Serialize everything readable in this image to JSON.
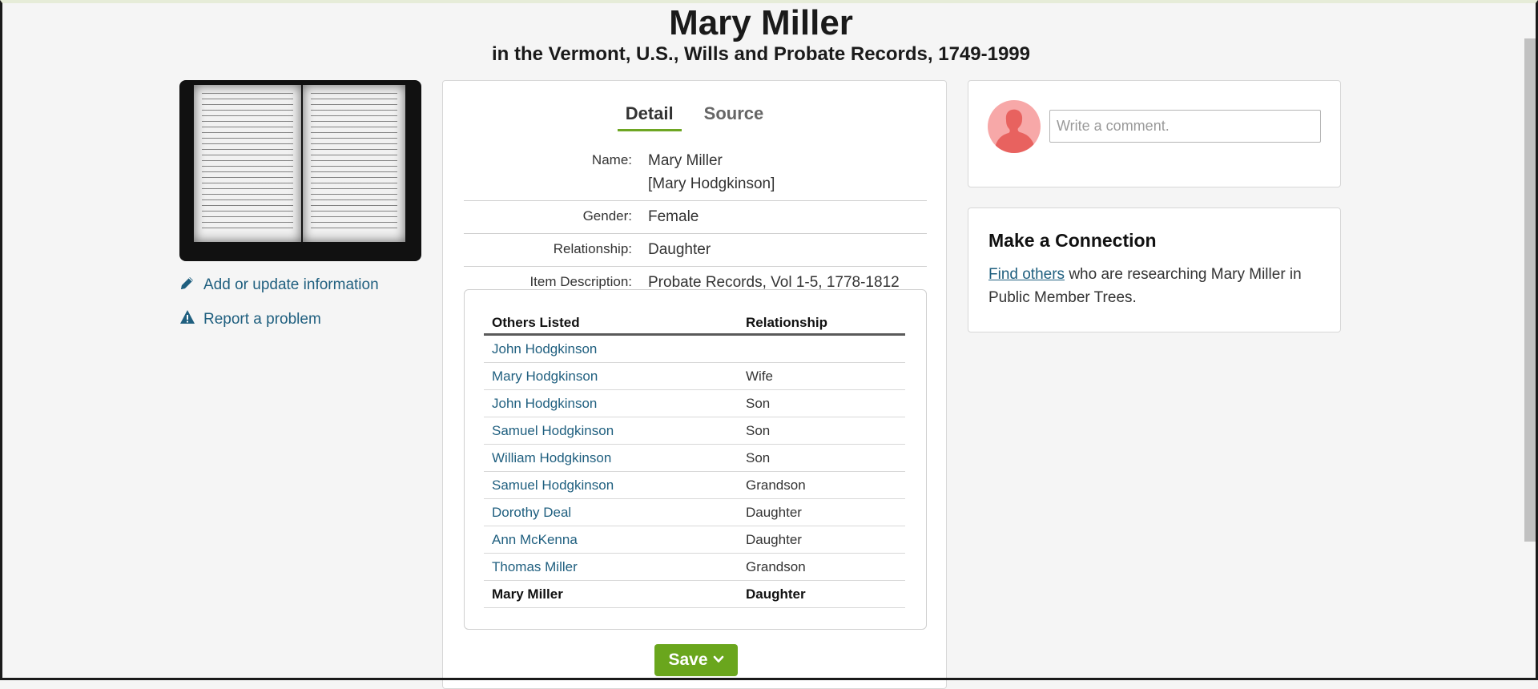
{
  "header": {
    "title": "Mary Miller",
    "subtitle": "in the Vermont, U.S., Wills and Probate Records, 1749-1999"
  },
  "sidebar": {
    "actions": [
      {
        "label": "Add or update information",
        "icon": "pencil-icon"
      },
      {
        "label": "Report a problem",
        "icon": "warning-icon"
      }
    ]
  },
  "tabs": [
    {
      "label": "Detail",
      "active": true
    },
    {
      "label": "Source",
      "active": false
    }
  ],
  "details": {
    "name": {
      "label": "Name:",
      "value": "Mary Miller",
      "alt": "[Mary Hodgkinson]"
    },
    "gender": {
      "label": "Gender:",
      "value": "Female"
    },
    "relationship": {
      "label": "Relationship:",
      "value": "Daughter"
    },
    "item_description": {
      "label": "Item Description:",
      "value": "Probate Records, Vol 1-5, 1778-1812"
    }
  },
  "others": {
    "headers": [
      "Others Listed",
      "Relationship"
    ],
    "rows": [
      {
        "name": "John Hodgkinson",
        "relationship": ""
      },
      {
        "name": "Mary Hodgkinson",
        "relationship": "Wife"
      },
      {
        "name": "John Hodgkinson",
        "relationship": "Son"
      },
      {
        "name": "Samuel Hodgkinson",
        "relationship": "Son"
      },
      {
        "name": "William Hodgkinson",
        "relationship": "Son"
      },
      {
        "name": "Samuel Hodgkinson",
        "relationship": "Grandson"
      },
      {
        "name": "Dorothy Deal",
        "relationship": "Daughter"
      },
      {
        "name": "Ann McKenna",
        "relationship": "Daughter"
      },
      {
        "name": "Thomas Miller",
        "relationship": "Grandson"
      }
    ],
    "self_row": {
      "name": "Mary Miller",
      "relationship": "Daughter"
    }
  },
  "save_button": {
    "label": "Save"
  },
  "comment": {
    "placeholder": "Write a comment."
  },
  "connection": {
    "title": "Make a Connection",
    "link_text": "Find others",
    "text": " who are researching Mary Miller in Public Member Trees."
  },
  "colors": {
    "link": "#1f5f7f",
    "accent_green": "#6aa61d",
    "avatar": "#f7a8a8",
    "avatar_figure": "#e8625f"
  }
}
